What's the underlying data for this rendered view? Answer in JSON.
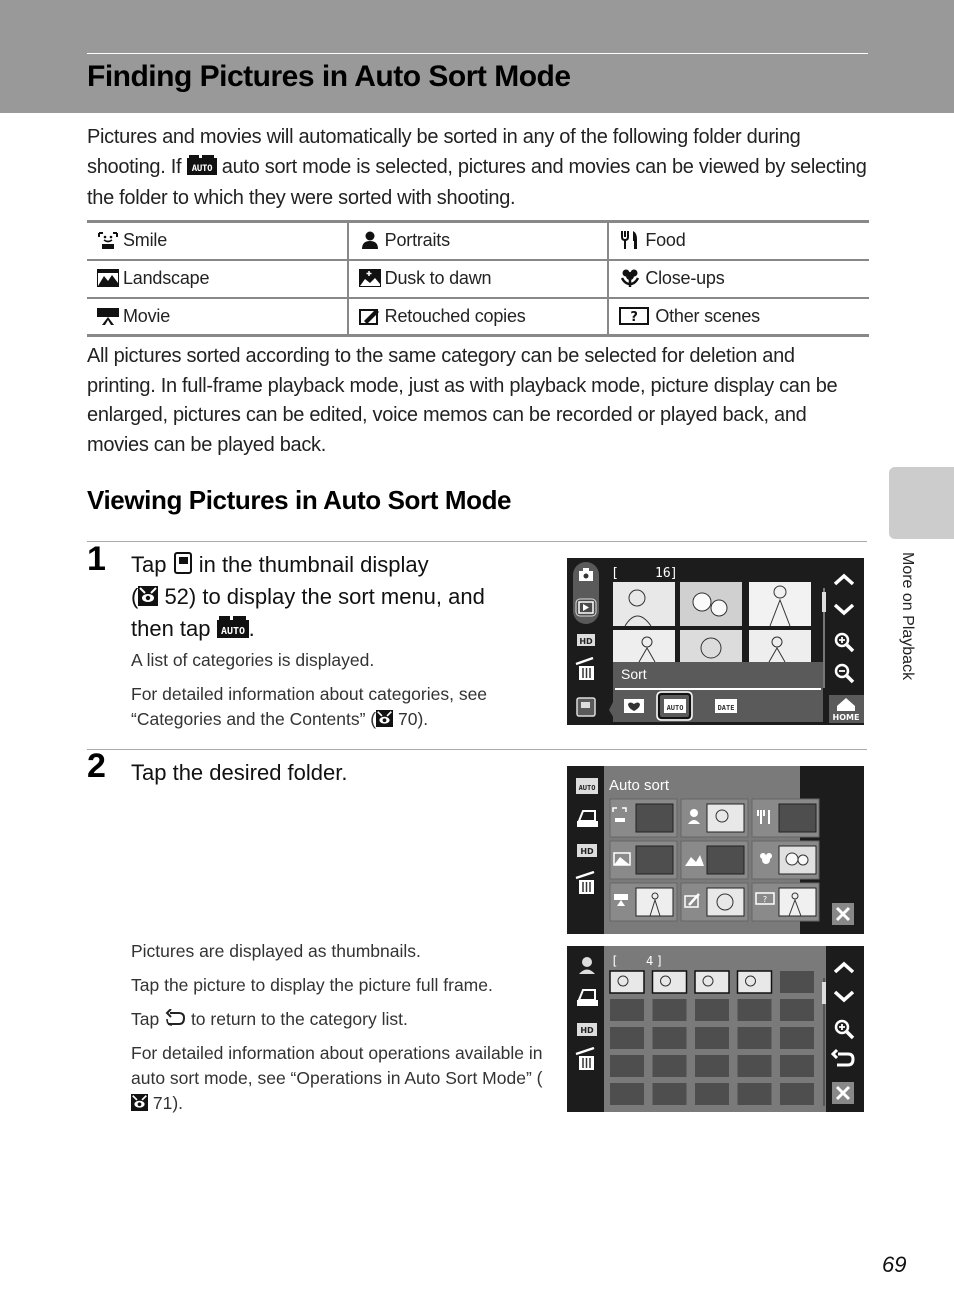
{
  "header": {
    "title": "Finding Pictures in Auto Sort Mode"
  },
  "intro": {
    "part1": "Pictures and movies will automatically be sorted in any of the following folder during shooting. If ",
    "icon": "auto-sort-icon",
    "part2": " auto sort mode is selected, pictures and movies can be viewed by selecting the folder to which they were sorted with shooting."
  },
  "categories": [
    [
      {
        "icon": "smile-icon",
        "label": "Smile"
      },
      {
        "icon": "portraits-icon",
        "label": "Portraits"
      },
      {
        "icon": "food-icon",
        "label": "Food"
      }
    ],
    [
      {
        "icon": "landscape-icon",
        "label": "Landscape"
      },
      {
        "icon": "dusk-to-dawn-icon",
        "label": "Dusk to dawn"
      },
      {
        "icon": "close-ups-icon",
        "label": "Close-ups"
      }
    ],
    [
      {
        "icon": "movie-icon",
        "label": "Movie"
      },
      {
        "icon": "retouched-copies-icon",
        "label": "Retouched copies"
      },
      {
        "icon": "other-scenes-icon",
        "label": "Other scenes"
      }
    ]
  ],
  "description": "All pictures sorted according to the same category can be selected for deletion and printing. In full-frame playback mode, just as with playback mode, picture display can be enlarged, pictures can be edited, voice memos can be recorded or played back, and movies can be played back.",
  "section": {
    "title": "Viewing Pictures in Auto Sort Mode"
  },
  "steps": [
    {
      "number": "1",
      "line1_a": "Tap ",
      "line1_b": " in the thumbnail display",
      "line2_a": "(",
      "line2_b": " 52) to display the sort menu, and",
      "line3_a": "then tap ",
      "line3_b": ".",
      "notes": [
        "A list of categories is displayed.",
        "For detailed information about categories, see “Categories and the Contents” (",
        " 70)."
      ]
    },
    {
      "number": "2",
      "text": "Tap the desired folder.",
      "notes": [
        "Pictures are displayed as thumbnails.",
        "Tap the picture to display the picture full frame.",
        "Tap ",
        " to return to the category list.",
        "For detailed information about operations available in auto sort mode, see “Operations in Auto Sort Mode” (",
        " 71)."
      ]
    }
  ],
  "screens": {
    "thumbnail": {
      "counter_open": "[",
      "counter": "16",
      "counter_close": "]",
      "sort_label": "Sort",
      "sort_options": [
        "favorites",
        "AUTO",
        "DATE"
      ],
      "selected_option": "AUTO",
      "home_label": "HOME"
    },
    "auto_sort": {
      "title": "Auto sort"
    },
    "category_view": {
      "counter_open": "[",
      "counter": "4",
      "counter_close": "]",
      "filled_thumbnails": 4,
      "total_cells": 25
    }
  },
  "sidebar": {
    "label": "More on Playback"
  },
  "footer": {
    "page_number": "69"
  },
  "colors": {
    "header_band": "#999999",
    "side_tab": "#cccccc",
    "screen_bg": "#1c1c1c",
    "screen_panel": "#7a7a7a",
    "thumb_empty": "#4e4e4e"
  }
}
